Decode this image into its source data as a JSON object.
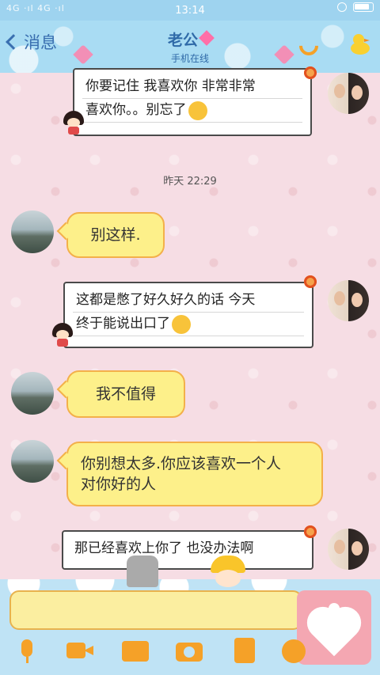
{
  "status_bar": {
    "left": "4G ·ıl 4G ·ıl",
    "time": "13:14"
  },
  "header": {
    "back_label": "消息",
    "title": "老公",
    "subtitle": "手机在线"
  },
  "messages": [
    {
      "side": "right",
      "style": "white",
      "lines": [
        "你要记住 我喜欢你 非常非常",
        "喜欢你。。别忘了"
      ]
    },
    {
      "type": "timestamp",
      "text": "昨天 22:29"
    },
    {
      "side": "left",
      "style": "yellow",
      "text": "别这样."
    },
    {
      "side": "right",
      "style": "white",
      "lines": [
        "这都是憋了好久好久的话 今天",
        "终于能说出口了"
      ]
    },
    {
      "side": "left",
      "style": "yellow",
      "text": "我不值得"
    },
    {
      "side": "left",
      "style": "yellow",
      "lines": [
        "你别想太多.你应该喜欢一个人",
        "对你好的人"
      ]
    },
    {
      "side": "right",
      "style": "white",
      "lines": [
        "那已经喜欢上你了 也没办法啊"
      ]
    }
  ],
  "input": {
    "value": "",
    "placeholder": ""
  },
  "colors": {
    "header_blue": "#a9dcf3",
    "title_blue": "#2f6aa8",
    "bubble_yellow": "#fdf08a",
    "bubble_border": "#f3b04a",
    "tool_orange": "#f5a128",
    "send_pink": "#f4a7b2"
  },
  "icons": [
    "signal-icon",
    "wifi-icon",
    "alarm-icon",
    "battery-icon",
    "back-chevron-icon",
    "heart-icon",
    "phone-icon",
    "duck-icon",
    "mic-icon",
    "video-icon",
    "image-icon",
    "camera-icon",
    "file-icon",
    "emoji-icon",
    "heart-send-icon"
  ]
}
